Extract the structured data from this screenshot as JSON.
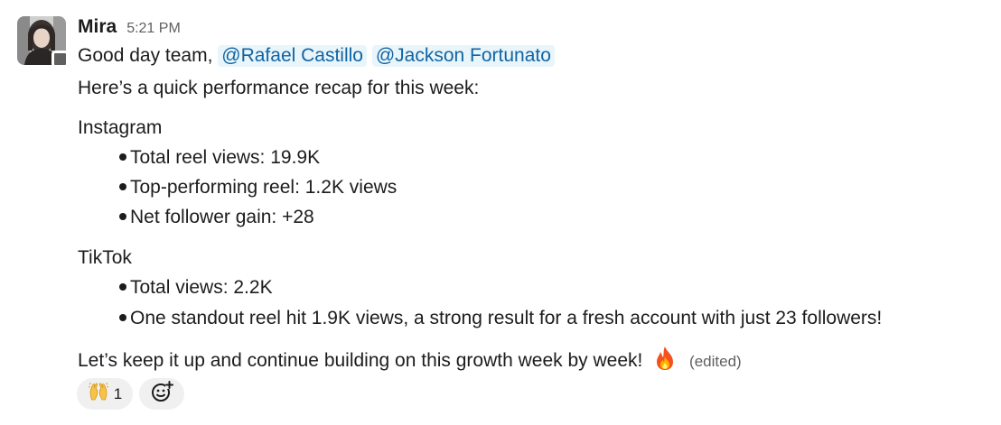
{
  "message": {
    "author": "Mira",
    "timestamp": "5:21 PM",
    "greeting": "Good day team,",
    "mentions": [
      "@Rafael Castillo",
      "@Jackson Fortunato"
    ],
    "intro": "Here’s a quick performance recap for this week:",
    "sections": [
      {
        "heading": "Instagram",
        "bullets": [
          "Total reel views: 19.9K",
          "Top-performing reel: 1.2K views",
          "Net follower gain: +28"
        ]
      },
      {
        "heading": "TikTok",
        "bullets": [
          "Total views: 2.2K",
          "One standout reel hit 1.9K views, a strong result for a fresh account with just 23 followers!"
        ]
      }
    ],
    "closing": "Let’s keep it up and continue building on this growth week by week!",
    "closing_emoji": "fire-icon",
    "edited_label": "(edited)"
  },
  "reactions": [
    {
      "emoji": "raised-hands-icon",
      "count": "1"
    }
  ],
  "add_reaction": {
    "icon": "add-reaction-icon"
  },
  "colors": {
    "text": "#1d1c1d",
    "muted": "#616061",
    "mention_bg": "#e8f5fa",
    "mention_text": "#1264a3",
    "reaction_bg": "#f0f0f0"
  }
}
